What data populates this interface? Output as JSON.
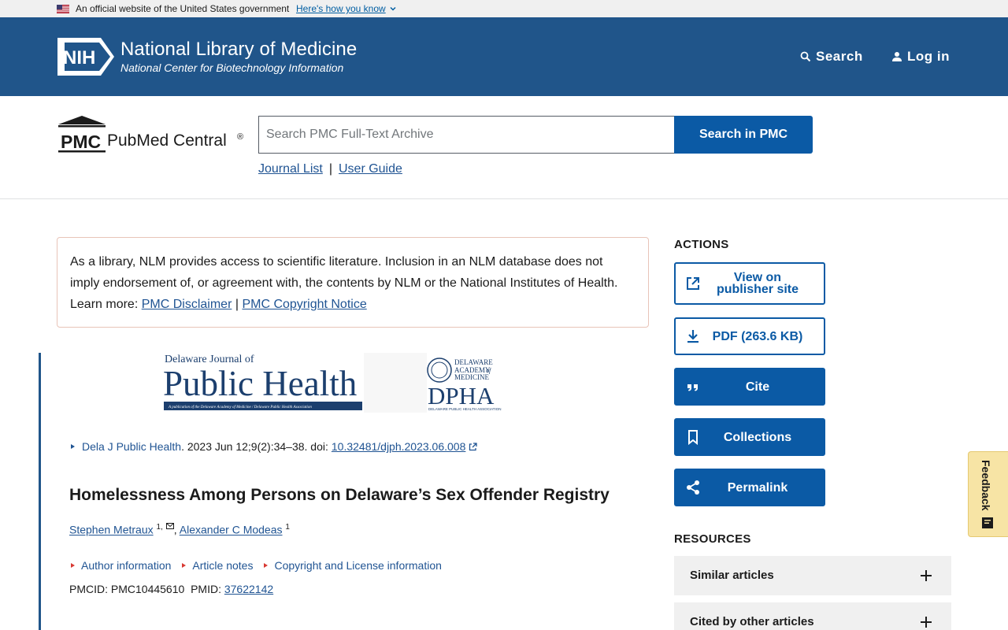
{
  "usa_banner": {
    "official_text": "An official website of the United States government",
    "how_link": "Here's how you know"
  },
  "nih_header": {
    "logo_text": "NIH",
    "title": "National Library of Medicine",
    "subtitle": "National Center for Biotechnology Information",
    "search_label": "Search",
    "login_label": "Log in"
  },
  "pmc_bar": {
    "logo_abbr": "PMC",
    "logo_name": "PubMed Central",
    "logo_reg": "®",
    "search_placeholder": "Search PMC Full-Text Archive",
    "search_button": "Search in PMC",
    "links": [
      "Journal List",
      "User Guide"
    ],
    "link_separator": "|"
  },
  "disclaimer": {
    "text": "As a library, NLM provides access to scientific literature. Inclusion in an NLM database does not imply endorsement of, or agreement with, the contents by NLM or the National Institutes of Health.",
    "learn_more": "Learn more:",
    "link1": "PMC Disclaimer",
    "separator": "|",
    "link2": "PMC Copyright Notice"
  },
  "journal_banner": {
    "small_title": "Delaware Journal of",
    "big_title": "Public Health",
    "tagline": "A publication of the Delaware Academy of Medicine / Delaware Public Health Association",
    "org_line1": "DELAWARE",
    "org_line2": "ACADEMY",
    "org_line3": "of",
    "org_line4": "MEDICINE",
    "org_abbr": "DPHA",
    "org_sub": "DELAWARE PUBLIC HEALTH ASSOCIATION"
  },
  "article": {
    "journal": "Dela J Public Health",
    "citation": ". 2023 Jun 12;9(2):34–38. doi:",
    "doi": "10.32481/djph.2023.06.008",
    "title": "Homelessness Among Persons on Delaware’s Sex Offender Registry",
    "authors": [
      {
        "name": "Stephen Metraux",
        "sup": "1,"
      },
      {
        "name": "Alexander C Modeas",
        "sup": "1"
      }
    ],
    "author_separator": ", ",
    "info_links": [
      "Author information",
      "Article notes",
      "Copyright and License information"
    ],
    "pmcid_label": "PMCID:",
    "pmcid": "PMC10445610",
    "pmid_label": "PMID:",
    "pmid": "37622142"
  },
  "actions": {
    "heading": "ACTIONS",
    "view_publisher_line1": "View on",
    "view_publisher_line2": "publisher site",
    "pdf": "PDF (263.6 KB)",
    "cite": "Cite",
    "collections": "Collections",
    "permalink": "Permalink"
  },
  "resources": {
    "heading": "RESOURCES",
    "items": [
      "Similar articles",
      "Cited by other articles"
    ]
  },
  "feedback": {
    "label": "Feedback"
  },
  "colors": {
    "header_blue": "#20558a",
    "button_blue": "#0b5aa5",
    "link_blue": "#205493",
    "accent_red": "#d83933",
    "feedback_yellow": "#f7e4a5"
  }
}
